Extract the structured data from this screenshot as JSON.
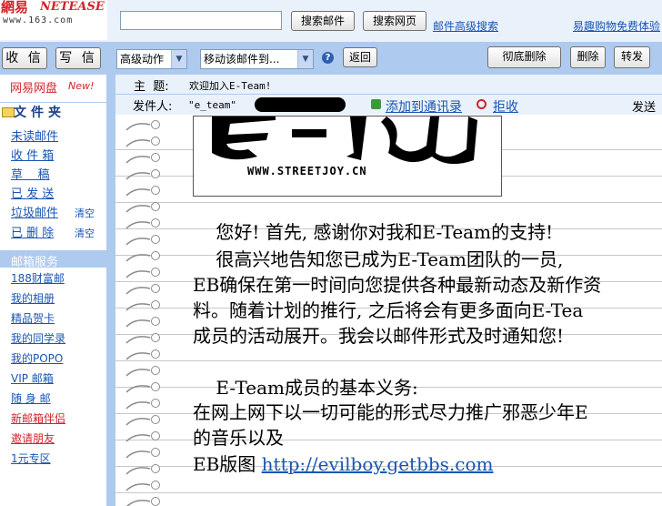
{
  "header": {
    "logo_brand": "網易",
    "logo_brand_latin": "NETEASE",
    "logo_domain": "www.163.com",
    "search_placeholder": "",
    "search_mail_label": "搜索邮件",
    "search_web_label": "搜索网页",
    "advanced_search_label": "邮件高级搜索",
    "shopping_link": "易趣购物免费体验"
  },
  "toolbar": {
    "receive_label": "收 信",
    "write_label": "写 信",
    "action_select": "高级动作",
    "move_select": "移动该邮件到...",
    "help_glyph": "?",
    "back_label": "返回",
    "perm_delete_label": "彻底删除",
    "delete_label": "删除",
    "forward_label": "转发"
  },
  "sidebar": {
    "netdisk_label": "网易网盘",
    "netdisk_badge": "New!",
    "folder_title": "文件夹",
    "folders": [
      {
        "label": "未读邮件",
        "clear": ""
      },
      {
        "label": "收 件 箱",
        "clear": ""
      },
      {
        "label": "草    稿",
        "clear": ""
      },
      {
        "label": "已 发 送",
        "clear": ""
      },
      {
        "label": "垃圾邮件",
        "clear": "清空"
      },
      {
        "label": "已 删 除",
        "clear": "清空"
      }
    ],
    "services_title": "邮箱服务",
    "services": [
      {
        "label": "188财富邮"
      },
      {
        "label": "我的相册"
      },
      {
        "label": "精品贺卡"
      },
      {
        "label": "我的同学录"
      },
      {
        "label": "我的POPO"
      },
      {
        "label": "VIP 邮箱"
      },
      {
        "label": "随 身 邮"
      },
      {
        "label": "新邮箱伴侣"
      },
      {
        "label": "邀请朋友"
      },
      {
        "label": "1元专区"
      }
    ]
  },
  "message": {
    "subject_label": "主  题:",
    "subject_value": "欢迎加入E-Team!",
    "sender_label": "发件人:",
    "sender_value": "\"e_team\"",
    "add_contact_label": "添加到通讯录",
    "reject_label": "拒收",
    "time_label": "发送日",
    "banner_url": "WWW.STREETJOY.CN",
    "body_lines": [
      "    您好! 首先, 感谢你对我和E-Team的支持!",
      "    很高兴地告知您已成为E-Team团队的一员,",
      "EB确保在第一时间向您提供各种最新动态及新作资",
      "料。随着计划的推行, 之后将会有更多面向E-Tea",
      "成员的活动展开。我会以邮件形式及时通知您!",
      "",
      "    E-Team成员的基本义务:",
      "在网上网下以一切可能的形式尽力推广邪恶少年E",
      "的音乐以及",
      "EB版图 "
    ],
    "link_text": "http://evilboy.getbbs.com"
  }
}
